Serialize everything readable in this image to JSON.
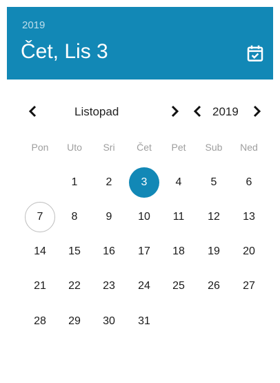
{
  "header": {
    "year": "2019",
    "date": "Čet, Lis 3",
    "icon": "calendar-check-icon"
  },
  "nav": {
    "month": "Listopad",
    "year": "2019",
    "prev_month_icon": "chevron-left-icon",
    "next_month_icon": "chevron-right-icon",
    "prev_year_icon": "chevron-left-icon",
    "next_year_icon": "chevron-right-icon"
  },
  "weekdays": [
    "Pon",
    "Uto",
    "Sri",
    "Čet",
    "Pet",
    "Sub",
    "Ned"
  ],
  "month": {
    "first_weekday_index": 1,
    "days_in_month": 31,
    "selected_day": 3,
    "today": 7
  },
  "colors": {
    "accent": "#1288b6",
    "weekday_text": "#9e9e9e",
    "today_ring": "#bdbdbd"
  }
}
